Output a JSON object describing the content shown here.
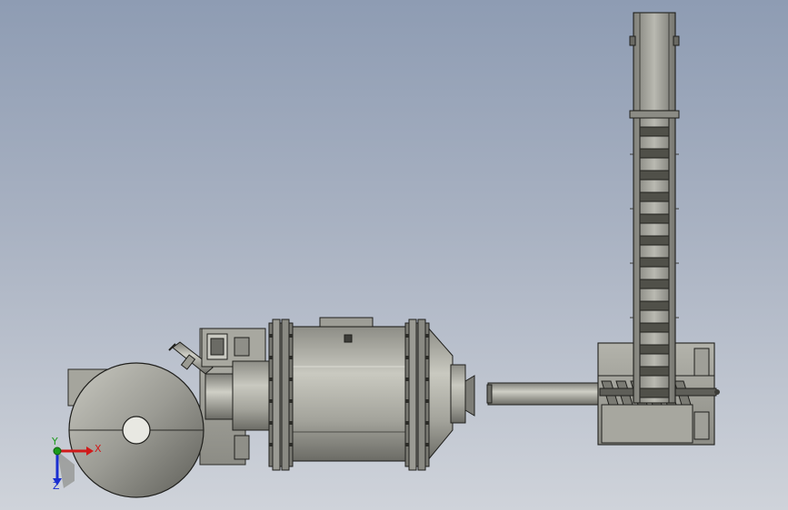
{
  "viewport": {
    "background_top": "#8e9cb3",
    "background_bottom": "#cfd3da"
  },
  "model": {
    "components": [
      "hopper-cone",
      "feed-inlet-pipe",
      "rotary-drum-dryer",
      "screw-conveyor",
      "bucket-elevator"
    ],
    "colors": {
      "metal_light": "#c4c4bb",
      "metal_mid": "#9a9a92",
      "metal_dark": "#55554f",
      "outline": "#1f1f1c"
    }
  },
  "triad": {
    "x_label": "X",
    "y_label": "Y",
    "z_label": "Z",
    "x_color": "#d11a1a",
    "y_color": "#1a9a1a",
    "z_color": "#1a2fd1"
  }
}
